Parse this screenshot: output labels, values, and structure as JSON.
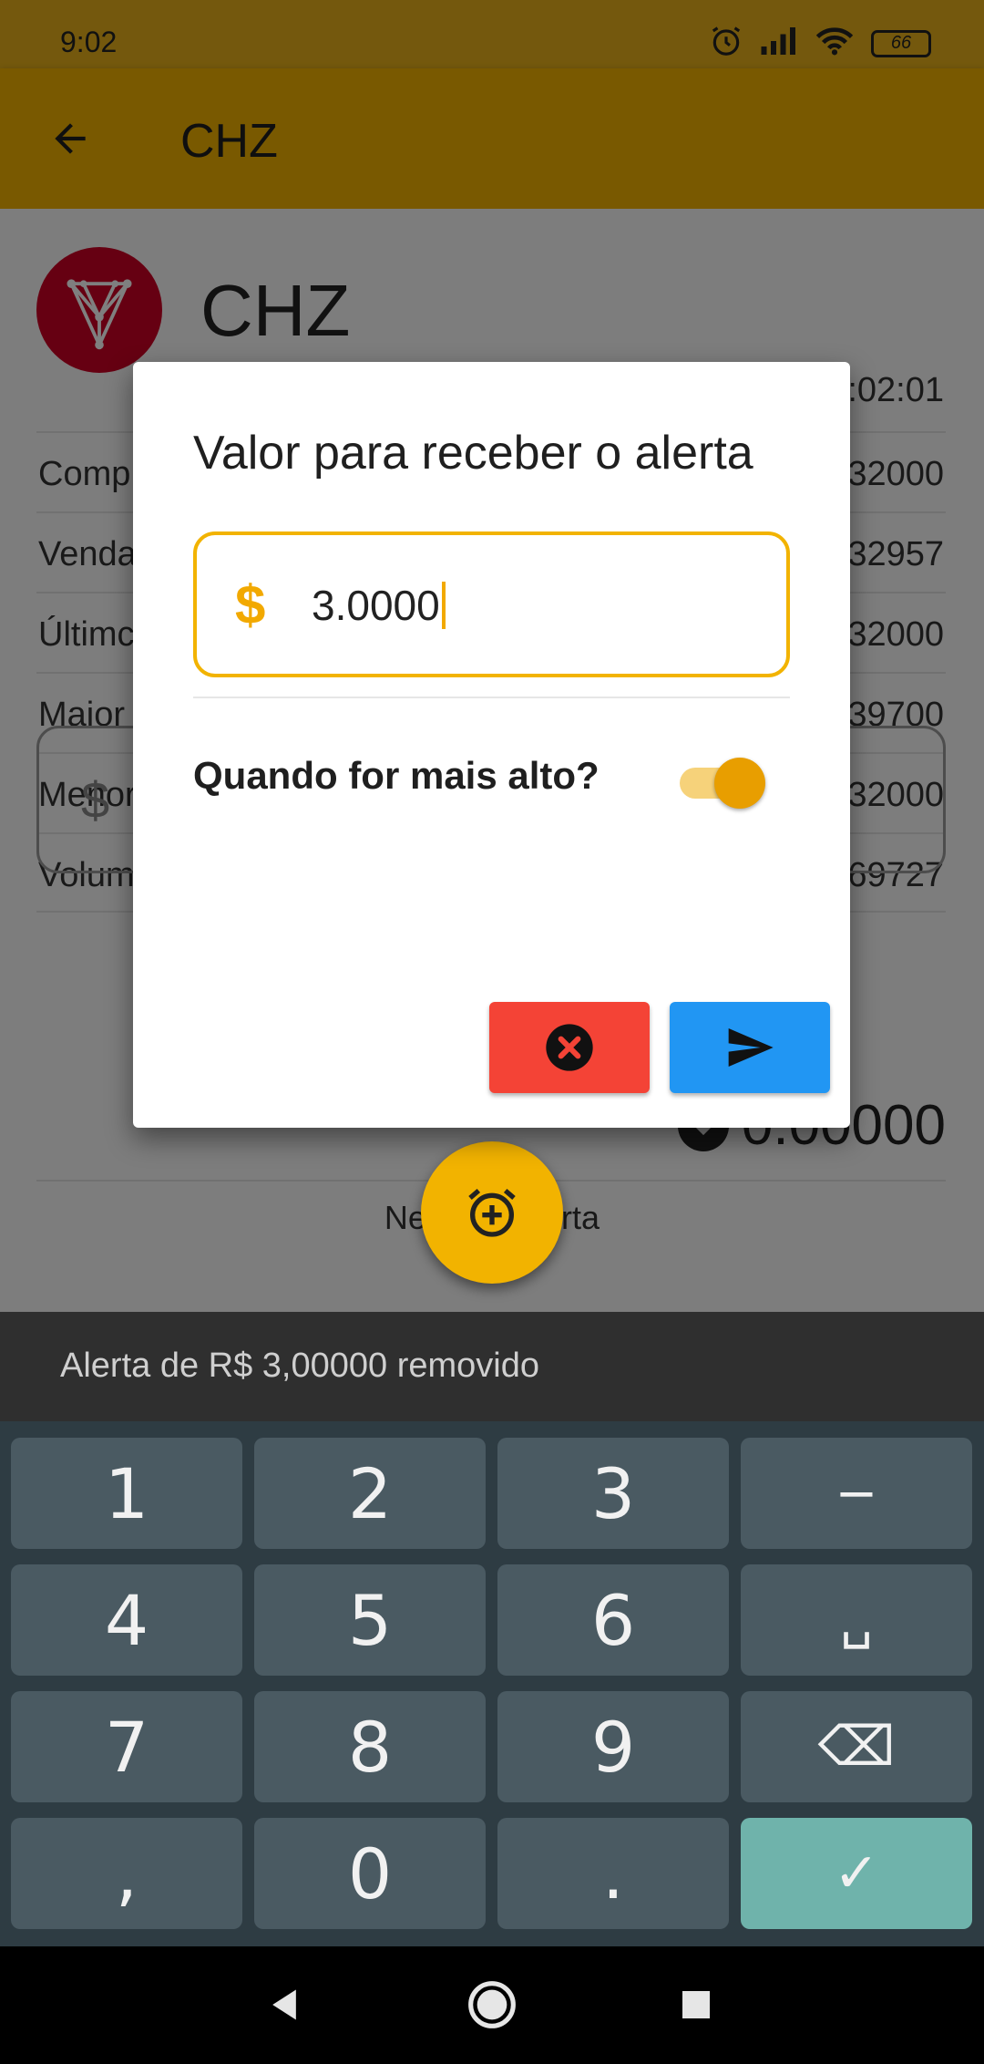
{
  "status_bar": {
    "time": "9:02",
    "battery": "66"
  },
  "app_bar": {
    "title": "CHZ"
  },
  "coin": {
    "name": "CHZ",
    "updated_time": ":02:01",
    "stats": [
      {
        "label": "Comp",
        "value": "32000"
      },
      {
        "label": "Venda",
        "value": "32957"
      },
      {
        "label": "Últimc",
        "value": "32000"
      },
      {
        "label": "Maior",
        "value": "39700"
      },
      {
        "label": "Menor",
        "value": "32000"
      },
      {
        "label": "Volum",
        "value": "69727"
      }
    ],
    "input_prefix": "$",
    "converted_value": "0.00000",
    "no_alert_text": "Nenhum alerta"
  },
  "dialog": {
    "title": "Valor para receber o alerta",
    "currency_symbol": "$",
    "amount": "3.0000",
    "toggle_label": "Quando for mais alto?",
    "toggle_on": true
  },
  "snackbar": {
    "message": "Alerta de R$ 3,00000 removido"
  },
  "keyboard": {
    "keys": [
      "1",
      "2",
      "3",
      "−",
      "4",
      "5",
      "6",
      "␣",
      "7",
      "8",
      "9",
      "⌫",
      ",",
      "0",
      ".",
      "✓"
    ]
  },
  "colors": {
    "primary": "#f2b300",
    "cancel": "#f44336",
    "send": "#2196f3",
    "coin": "#cd0124"
  }
}
